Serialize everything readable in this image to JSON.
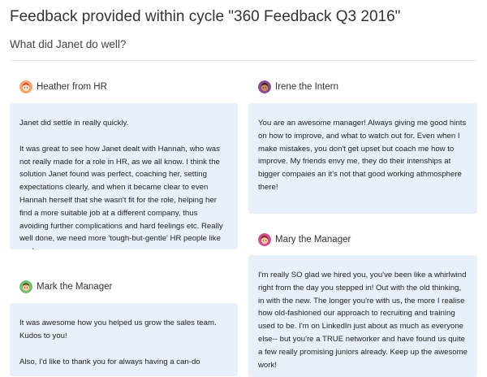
{
  "header": {
    "title": "Feedback provided within cycle \"360 Feedback Q3 2016\"",
    "question": "What did Janet do well?"
  },
  "feedbacks": [
    {
      "author": "Heather from HR",
      "avatar_icon": "avatar-heather-icon",
      "paragraphs": [
        "Janet did settle in really quickly.",
        "It was great to see how Janet dealt with Hannah, who was not really made for a role in HR, as we all know. I think the solution Janet found was perfect, coaching her, setting expectations clearly, and when it became clear to even Hannah herself that she wasn't fit for the role, helping her find a more suitable job at a different company, thus avoiding further complications and hard feelings etc. Really well done, we need more 'tough-but-gentle' HR people like you!"
      ]
    },
    {
      "author": "Irene the Intern",
      "avatar_icon": "avatar-irene-icon",
      "paragraphs": [
        "You are an awesome manager! Always giving me good hints on how to improve, and what to watch out for. Even when I make mistakes, you don't get upset but coach me how to improve. My friends envy me, they do their intenships at bigger compaies an it's not that good working athmosphere there!"
      ]
    },
    {
      "author": "Mark the Manager",
      "avatar_icon": "avatar-mark-icon",
      "paragraphs": [
        "It was awesome how you helped us grow the sales team. Kudos to you!",
        "Also, I'd like to thank you for always having a can-do"
      ]
    },
    {
      "author": "Mary the Manager",
      "avatar_icon": "avatar-mary-icon",
      "paragraphs": [
        "I'm really SO glad we hired you, you've been like a whirlwind right from the day you stepped in! Out with the old thinking, in with the new. The longer you're with us, the more I realise how old-fashioned our approach to recruiting and training used to be. I'm on LinkedIn just about as much as everyone else-- but you're a TRUE networker and have found us quite a few really promising juniors already. Keep up the awesome work!"
      ]
    }
  ]
}
